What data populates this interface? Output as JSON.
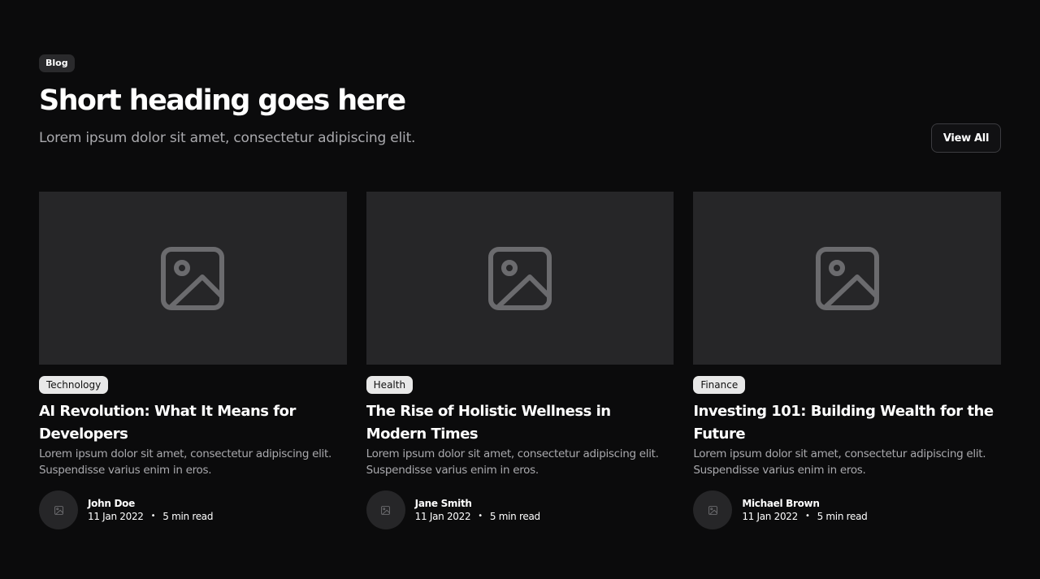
{
  "header": {
    "tag": "Blog",
    "title": "Short heading goes here",
    "subtitle": "Lorem ipsum dolor sit amet, consectetur adipiscing elit.",
    "view_all_label": "View All"
  },
  "posts": [
    {
      "category": "Technology",
      "title": "AI Revolution: What It Means for Developers",
      "description": "Lorem ipsum dolor sit amet, consectetur adipiscing elit. Suspendisse varius enim in eros.",
      "author": "John Doe",
      "date": "11 Jan 2022",
      "separator": "•",
      "read_time": "5 min read"
    },
    {
      "category": "Health",
      "title": "The Rise of Holistic Wellness in Modern Times",
      "description": "Lorem ipsum dolor sit amet, consectetur adipiscing elit. Suspendisse varius enim in eros.",
      "author": "Jane Smith",
      "date": "11 Jan 2022",
      "separator": "•",
      "read_time": "5 min read"
    },
    {
      "category": "Finance",
      "title": "Investing 101: Building Wealth for the Future",
      "description": "Lorem ipsum dolor sit amet, consectetur adipiscing elit. Suspendisse varius enim in eros.",
      "author": "Michael Brown",
      "date": "11 Jan 2022",
      "separator": "•",
      "read_time": "5 min read"
    }
  ],
  "icons": {
    "thumbnail": "image-placeholder-icon",
    "avatar": "image-placeholder-icon"
  },
  "colors": {
    "background": "#0b0b0c",
    "card_image": "#262628",
    "muted_text": "#a9a9ad",
    "tag_light": "#e8e8e8",
    "tag_dark": "#2a2a2c"
  }
}
